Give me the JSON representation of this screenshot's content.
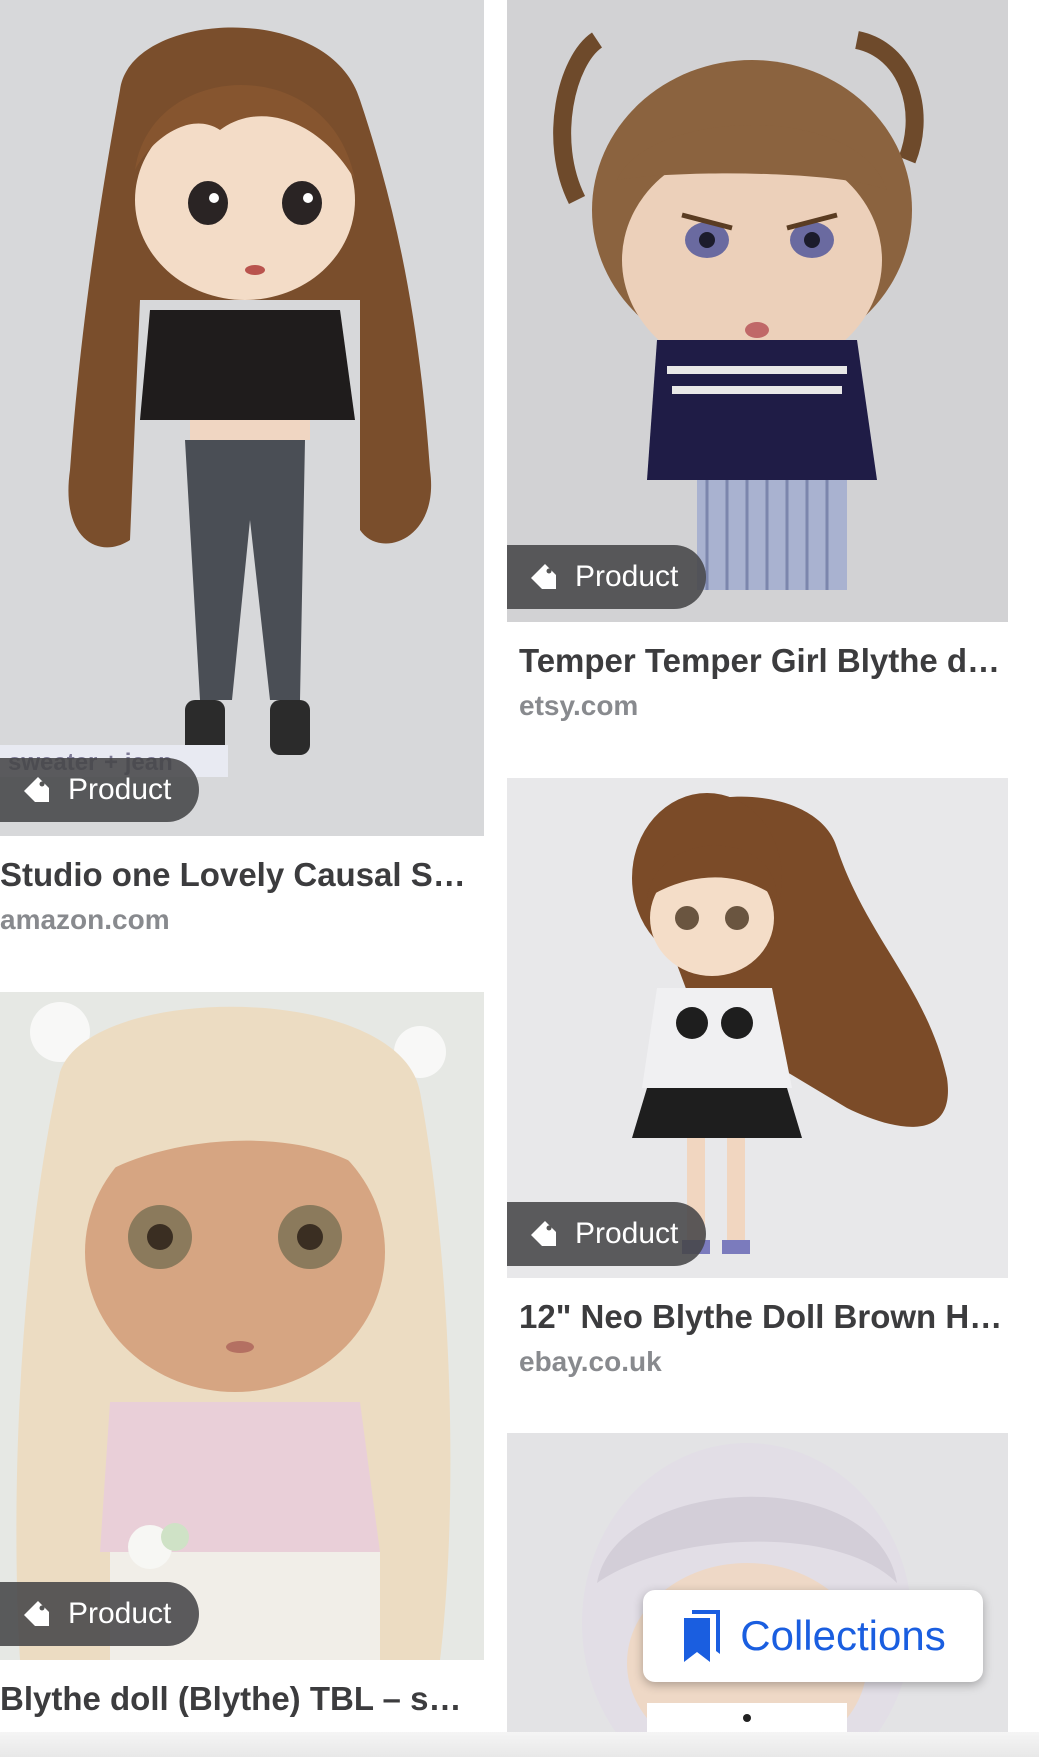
{
  "results": [
    {
      "badge": "Product",
      "title": "Studio one Lovely Causal Sw…",
      "domain": "amazon.com",
      "image_icon": "doll-brown-hair-black-sweater-image"
    },
    {
      "badge": "Product",
      "title": "Temper Temper Girl Blythe do…",
      "domain": "etsy.com",
      "image_icon": "doll-pigtails-navy-sweater-image"
    },
    {
      "badge": "Product",
      "title": "12\" Neo Blythe Doll Brown Ha…",
      "domain": "ebay.co.uk",
      "image_icon": "doll-panda-shirt-image"
    },
    {
      "badge": "Product",
      "title": "Blythe doll (Blythe) TBL – sho…",
      "domain": "",
      "image_icon": "doll-blonde-pink-cardigan-image"
    },
    {
      "badge": "",
      "title": "",
      "domain": "",
      "image_icon": "doll-silver-hair-image"
    }
  ],
  "image_text": {
    "sweater_tag": "sweater + jean"
  },
  "collections": {
    "label": "Collections",
    "icon": "bookmarks-icon",
    "color": "#1a5ee0"
  }
}
